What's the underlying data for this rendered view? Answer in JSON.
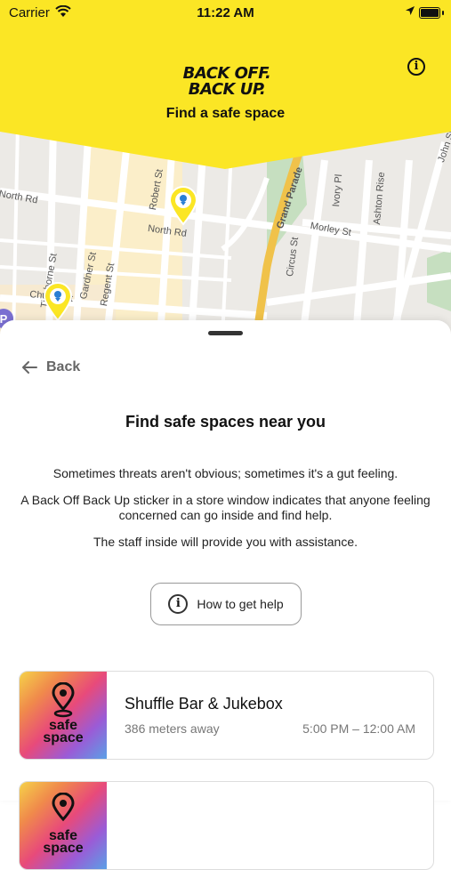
{
  "status_bar": {
    "carrier": "Carrier",
    "time": "11:22 AM"
  },
  "header": {
    "logo_line1": "BACK OFF.",
    "logo_line2": "BACK UP.",
    "title": "Find a safe space",
    "background_color": "#fbe625"
  },
  "map": {
    "streets": [
      "North Rd",
      "Robert St",
      "North Rd",
      "Tichborne St",
      "Gardner St",
      "Regent St",
      "Grand Parade",
      "Ivory Pl",
      "Ashton Rise",
      "Morley St",
      "Circus St",
      "John St",
      "Church St"
    ]
  },
  "sheet": {
    "back_label": "Back",
    "title": "Find safe spaces near you",
    "paragraphs": [
      "Sometimes threats aren't obvious; sometimes it's a gut feeling.",
      "A Back Off Back Up sticker in a store window indicates that anyone feeling concerned can go inside and find help.",
      "The staff inside will provide you with assistance."
    ],
    "help_button_label": "How to get help"
  },
  "places": [
    {
      "badge_line1": "safe",
      "badge_line2": "space",
      "name": "Shuffle Bar & Jukebox",
      "distance": "386 meters away",
      "hours": "5:00 PM – 12:00 AM"
    },
    {
      "badge_line1": "safe",
      "badge_line2": "space",
      "name": "",
      "distance": "",
      "hours": ""
    }
  ]
}
